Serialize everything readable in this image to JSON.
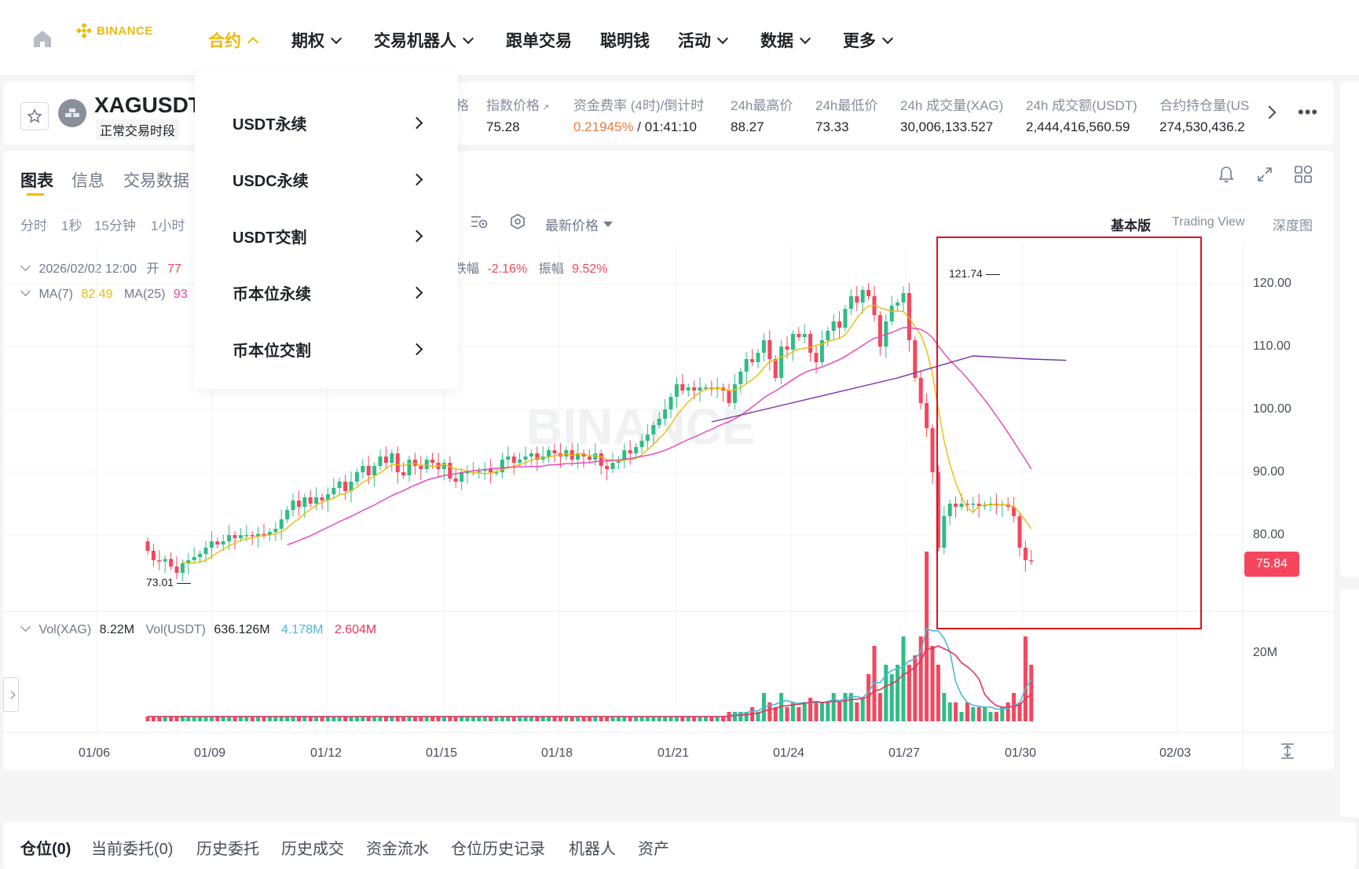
{
  "nav": {
    "logo_text": "BINANCE",
    "items": [
      {
        "label": "合约",
        "active": true,
        "arrow": "up"
      },
      {
        "label": "期权",
        "arrow": "down"
      },
      {
        "label": "交易机器人",
        "arrow": "down"
      },
      {
        "label": "跟单交易"
      },
      {
        "label": "聪明钱"
      },
      {
        "label": "活动",
        "arrow": "down"
      },
      {
        "label": "数据",
        "arrow": "down"
      },
      {
        "label": "更多",
        "arrow": "down"
      }
    ]
  },
  "dropdown": {
    "items": [
      "USDT永续",
      "USDC永续",
      "USDT交割",
      "币本位永续",
      "币本位交割"
    ]
  },
  "ticker": {
    "symbol": "XAGUSDT",
    "session": "正常交易时段",
    "partial_label": "格",
    "stats": [
      {
        "label": "指数价格",
        "value": "75.28"
      },
      {
        "label": "资金费率 (4时)/倒计时",
        "value_rate": "0.21945%",
        "value_timer": " / 01:41:10"
      },
      {
        "label": "24h最高价",
        "value": "88.27"
      },
      {
        "label": "24h最低价",
        "value": "73.33"
      },
      {
        "label": "24h 成交量(XAG)",
        "value": "30,006,133.527"
      },
      {
        "label": "24h 成交额(USDT)",
        "value": "2,444,416,560.59"
      },
      {
        "label": "合约持仓量(US",
        "value": "274,530,436.2"
      }
    ]
  },
  "chart_tabs": [
    "图表",
    "信息",
    "交易数据"
  ],
  "intervals": [
    "分时",
    "1秒",
    "15分钟",
    "1小时"
  ],
  "toolbar": {
    "price_type": "最新价格",
    "views": [
      "基本版",
      "Trading View",
      "深度图"
    ]
  },
  "legend": {
    "date": "2026/02/02 12:00",
    "open_label": "开",
    "open_val": "77",
    "change_label": "跌幅",
    "change_val": "-2.16%",
    "amp_label": "振幅",
    "amp_val": "9.52%",
    "ma7_label": "MA(7)",
    "ma7_val": "82.49",
    "ma25_label": "MA(25)",
    "ma25_val": "93"
  },
  "vol_legend": {
    "vol_xag_label": "Vol(XAG)",
    "vol_xag_val": "8.22M",
    "vol_usdt_label": "Vol(USDT)",
    "vol_usdt_val": "636.126M",
    "ma_a": "4.178M",
    "ma_b": "2.604M"
  },
  "current_price": "75.84",
  "high_marker": "121.74",
  "low_marker": "73.01",
  "colors": {
    "up": "#2ebd85",
    "down": "#f6465d",
    "accent": "#f0b90b",
    "ma7": "#f0b90b",
    "ma25": "#eb40b5",
    "ma99": "#7b2fa6",
    "highlight": "#e0101a"
  },
  "bottom_tabs": [
    "仓位(0)",
    "当前委托(0)",
    "历史委托",
    "历史成交",
    "资金流水",
    "仓位历史记录",
    "机器人",
    "资产"
  ],
  "chart_data": {
    "type": "candlestick",
    "y_ticks": [
      "120.00",
      "110.00",
      "100.00",
      "90.00",
      "80.00"
    ],
    "vol_tick": "20M",
    "x_ticks": [
      "01/06",
      "01/09",
      "01/12",
      "01/15",
      "01/18",
      "01/21",
      "01/24",
      "01/27",
      "01/30",
      "02/03"
    ],
    "ylim": [
      68,
      124
    ],
    "closes": [
      77.5,
      76.0,
      75.8,
      76.2,
      75.0,
      74.0,
      75.5,
      76.0,
      76.5,
      77.0,
      78.0,
      79.0,
      78.5,
      79.0,
      80.0,
      79.5,
      80.0,
      80.0,
      79.8,
      80.2,
      80.0,
      80.5,
      81.0,
      82.5,
      84.0,
      85.5,
      84.5,
      86.0,
      85.0,
      86.0,
      85.5,
      86.5,
      87.5,
      88.5,
      87.0,
      88.5,
      90.0,
      91.0,
      89.5,
      91.0,
      92.5,
      91.5,
      93.0,
      90.0,
      89.5,
      92.0,
      91.0,
      90.5,
      92.0,
      91.5,
      90.5,
      91.5,
      89.0,
      88.5,
      90.0,
      90.0,
      90.0,
      90.2,
      90.5,
      90.0,
      90.0,
      92.0,
      92.5,
      91.5,
      92.0,
      92.5,
      93.0,
      92.0,
      92.5,
      93.5,
      93.0,
      92.5,
      93.5,
      92.0,
      93.0,
      92.5,
      92.0,
      93.0,
      91.0,
      90.5,
      91.5,
      92.0,
      93.5,
      93.0,
      94.0,
      95.0,
      96.0,
      97.5,
      98.5,
      100.0,
      102.0,
      104.0,
      103.0,
      103.5,
      103.0,
      103.5,
      103.5,
      103.2,
      103.5,
      103.0,
      101.0,
      104.0,
      106.0,
      108.0,
      107.5,
      109.0,
      111.0,
      108.0,
      105.0,
      110.0,
      109.5,
      112.0,
      111.5,
      112.0,
      109.0,
      107.5,
      111.0,
      112.5,
      114.0,
      113.0,
      116.0,
      118.0,
      117.0,
      119.0,
      118.0,
      115.0,
      110.0,
      114.0,
      116.5,
      117.0,
      118.5,
      111.0,
      105.0,
      101.0,
      97.0,
      90.0,
      78.0,
      83.0,
      85.0,
      84.5,
      85.0,
      84.8,
      85.0,
      84.6,
      84.8,
      85.0,
      84.7,
      84.9,
      84.5,
      83.0,
      78.0,
      76.0,
      75.84
    ],
    "ma7_start": 6,
    "ma25_start": 24,
    "ma99_line": [
      [
        97.0,
        98.0
      ],
      [
        129.0,
        105.0
      ],
      [
        142.0,
        108.5
      ],
      [
        152.0,
        108.0
      ],
      [
        158.0,
        107.8
      ]
    ],
    "ma99_start_label": "",
    "volumes": [
      0.05,
      0.05,
      0.05,
      0.05,
      0.05,
      0.05,
      0.05,
      0.05,
      0.05,
      0.05,
      0.05,
      0.05,
      0.05,
      0.05,
      0.05,
      0.05,
      0.05,
      0.05,
      0.05,
      0.05,
      0.05,
      0.05,
      0.05,
      0.05,
      0.05,
      0.05,
      0.05,
      0.05,
      0.05,
      0.05,
      0.05,
      0.05,
      0.05,
      0.05,
      0.05,
      0.05,
      0.05,
      0.05,
      0.05,
      0.05,
      0.05,
      0.05,
      0.05,
      0.05,
      0.05,
      0.05,
      0.05,
      0.05,
      0.05,
      0.05,
      0.05,
      0.05,
      0.05,
      0.05,
      0.05,
      0.05,
      0.05,
      0.05,
      0.05,
      0.05,
      0.05,
      0.05,
      0.05,
      0.05,
      0.05,
      0.05,
      0.05,
      0.05,
      0.05,
      0.05,
      0.05,
      0.05,
      0.05,
      0.05,
      0.05,
      0.05,
      0.05,
      0.05,
      0.05,
      0.05,
      0.05,
      0.05,
      0.05,
      0.05,
      0.05,
      0.05,
      0.05,
      0.05,
      0.05,
      0.05,
      0.05,
      0.05,
      0.05,
      0.05,
      0.05,
      0.05,
      0.05,
      0.05,
      0.05,
      0.05,
      0.1,
      0.1,
      0.1,
      0.1,
      0.15,
      0.1,
      0.3,
      0.2,
      0.15,
      0.3,
      0.15,
      0.2,
      0.15,
      0.2,
      0.25,
      0.2,
      0.2,
      0.2,
      0.3,
      0.2,
      0.3,
      0.3,
      0.2,
      0.25,
      0.5,
      0.8,
      0.3,
      0.6,
      0.5,
      0.6,
      0.9,
      0.6,
      0.7,
      0.9,
      1.8,
      0.8,
      0.6,
      0.3,
      0.2,
      0.2,
      0.1,
      0.2,
      0.15,
      0.15,
      0.15,
      0.1,
      0.1,
      0.15,
      0.2,
      0.3,
      0.2,
      0.9,
      0.6
    ]
  }
}
